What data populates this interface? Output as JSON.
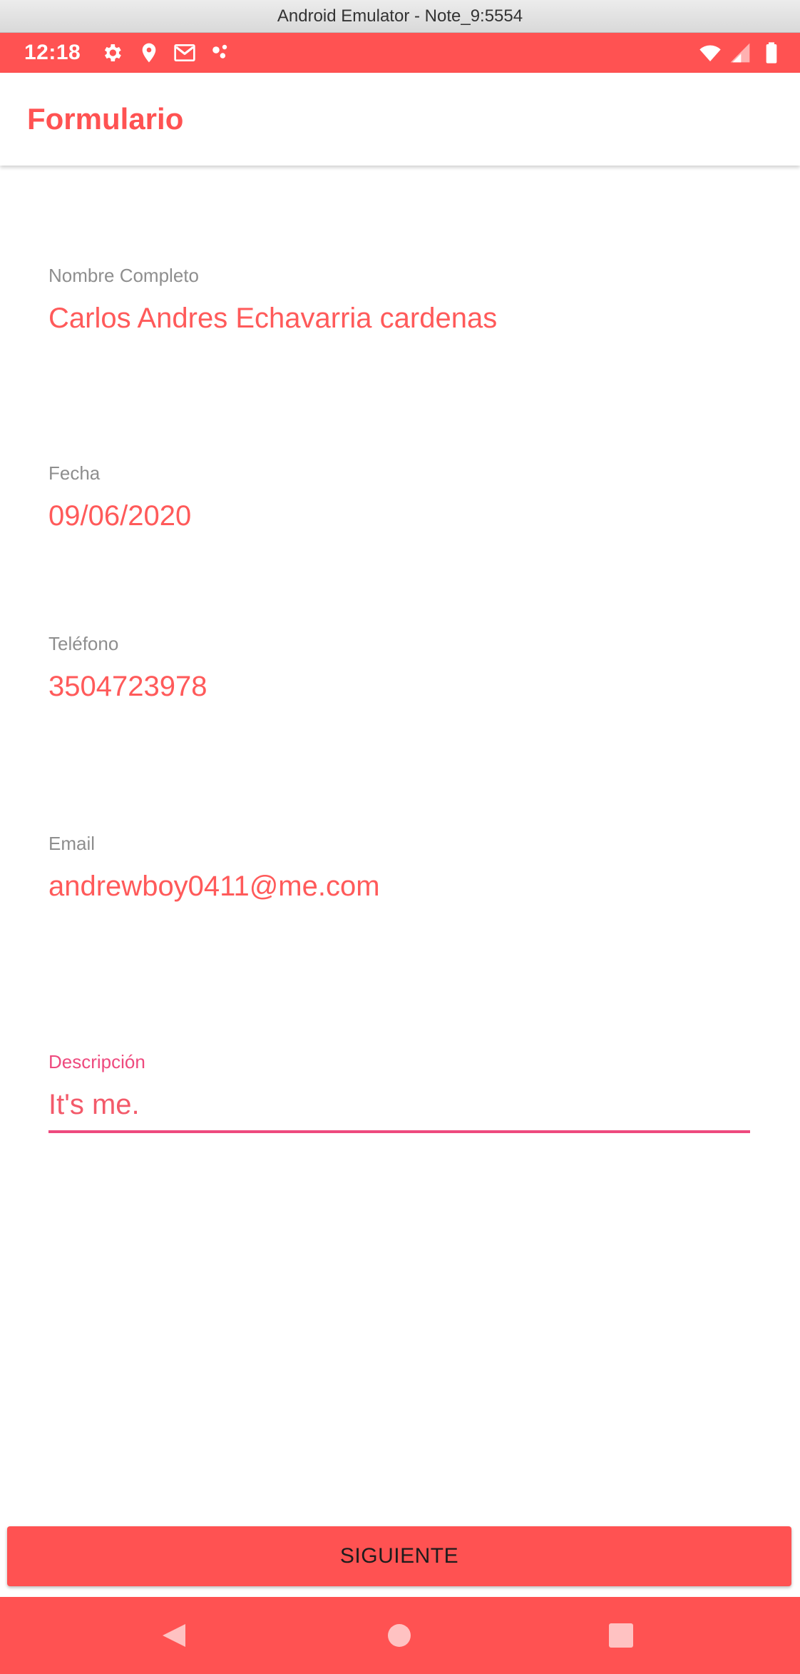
{
  "window": {
    "title": "Android Emulator - Note_9:5554"
  },
  "status_bar": {
    "time": "12:18",
    "left_icons": [
      "gear-icon",
      "location-pin-icon",
      "gmail-icon",
      "dots-icon"
    ],
    "right_icons": [
      "wifi-icon",
      "signal-icon",
      "battery-icon"
    ]
  },
  "app_bar": {
    "title": "Formulario"
  },
  "form": {
    "fields": [
      {
        "label": "Nombre Completo",
        "value": "Carlos Andres Echavarria cardenas"
      },
      {
        "label": "Fecha",
        "value": "09/06/2020"
      },
      {
        "label": "Teléfono",
        "value": "3504723978"
      },
      {
        "label": "Email",
        "value": "andrewboy0411@me.com"
      },
      {
        "label": "Descripción",
        "value": "It's me.",
        "focused": true
      }
    ]
  },
  "next_button": {
    "label": "SIGUIENTE"
  },
  "nav_bar": {
    "buttons": [
      "back-icon",
      "home-icon",
      "recents-icon"
    ]
  },
  "colors": {
    "primary": "#ff5252",
    "accent": "#ee4a7e",
    "label_gray": "#8e8e8e"
  }
}
